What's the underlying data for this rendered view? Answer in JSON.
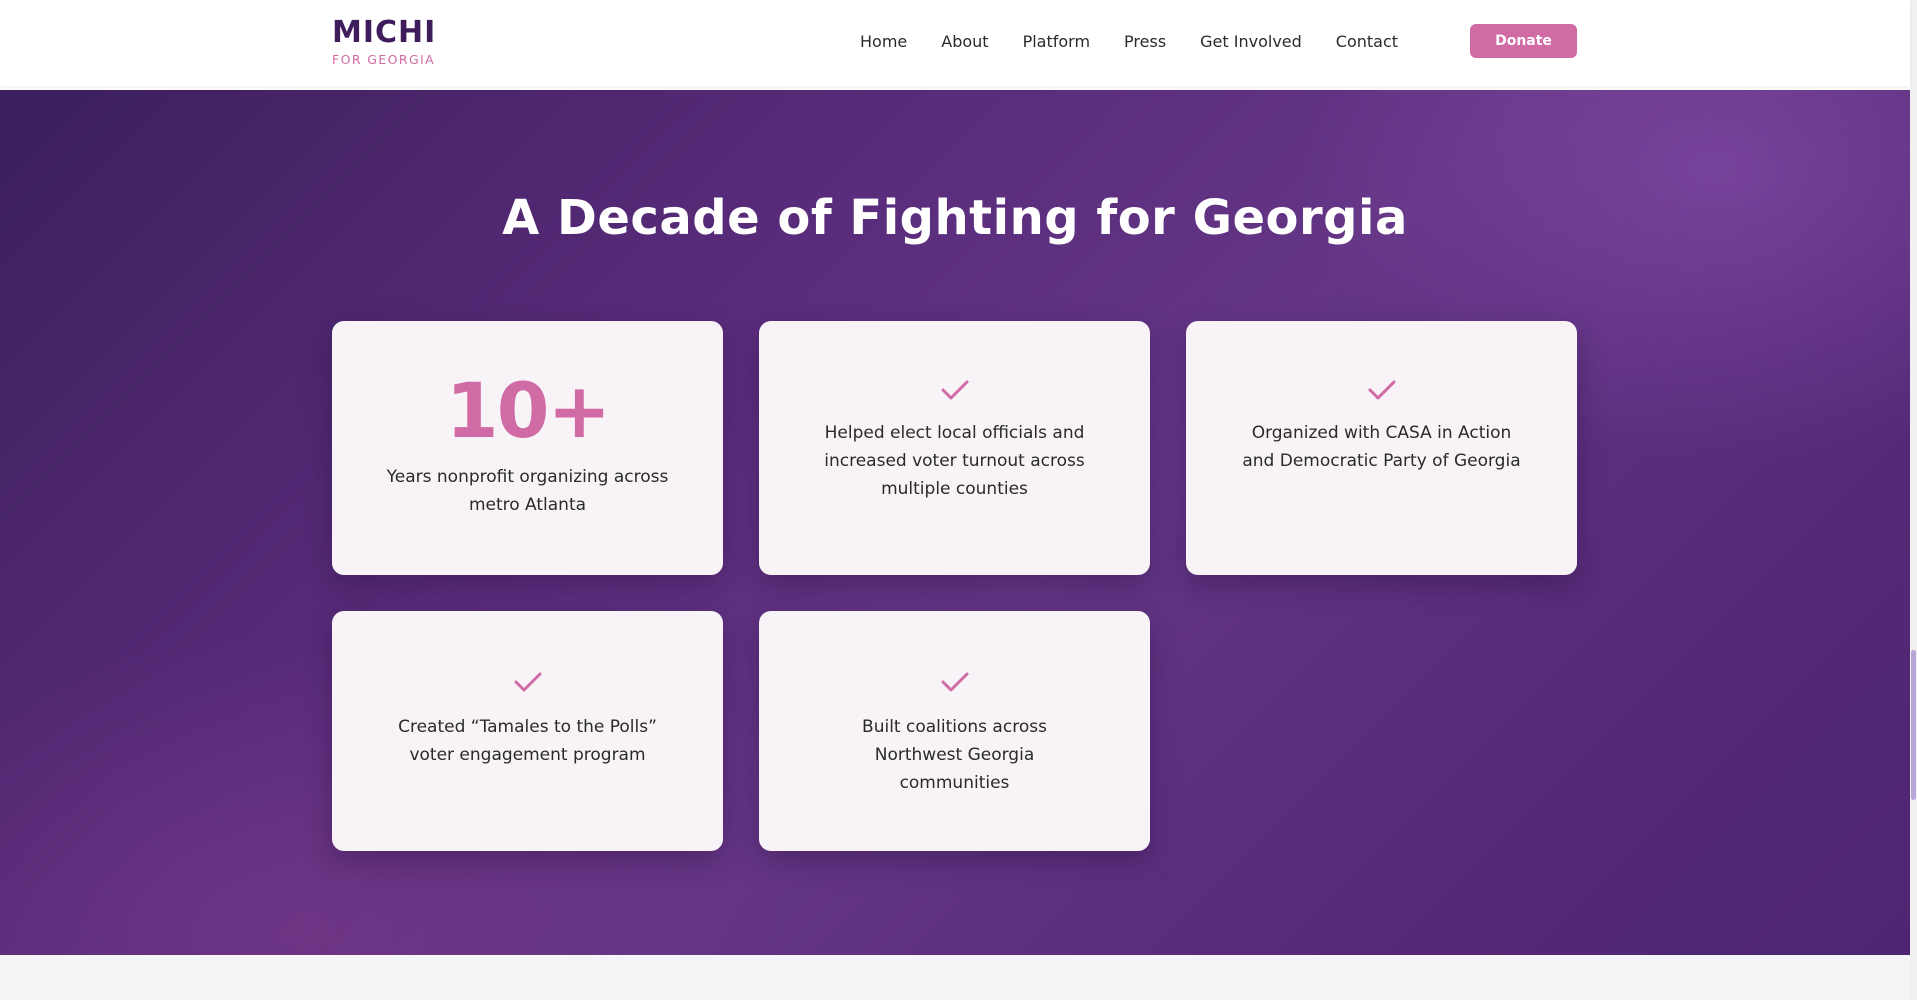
{
  "header": {
    "logo_main": "MICHI",
    "logo_sub": "FOR GEORGIA",
    "nav": [
      "Home",
      "About",
      "Platform",
      "Press",
      "Get Involved",
      "Contact"
    ],
    "donate_label": "Donate"
  },
  "hero": {
    "title": "A Decade of Fighting for Georgia",
    "stat_card": {
      "number": "10+",
      "text": "Years nonprofit organizing across metro Atlanta"
    },
    "cards": [
      {
        "icon": "check-icon",
        "text": "Helped elect local officials and increased voter turnout across multiple counties"
      },
      {
        "icon": "check-icon",
        "text": "Organized with CASA in Action and Democratic Party of Georgia"
      },
      {
        "icon": "check-icon",
        "text": "Created “Tamales to the Polls” voter engagement program"
      },
      {
        "icon": "check-icon",
        "text": "Built coalitions across Northwest Georgia communities"
      }
    ]
  },
  "colors": {
    "brand_purple": "#3f1d5c",
    "accent_pink": "#d16ba5",
    "card_bg": "#f7f3f7",
    "hero_bg": "#5a2c7c"
  }
}
